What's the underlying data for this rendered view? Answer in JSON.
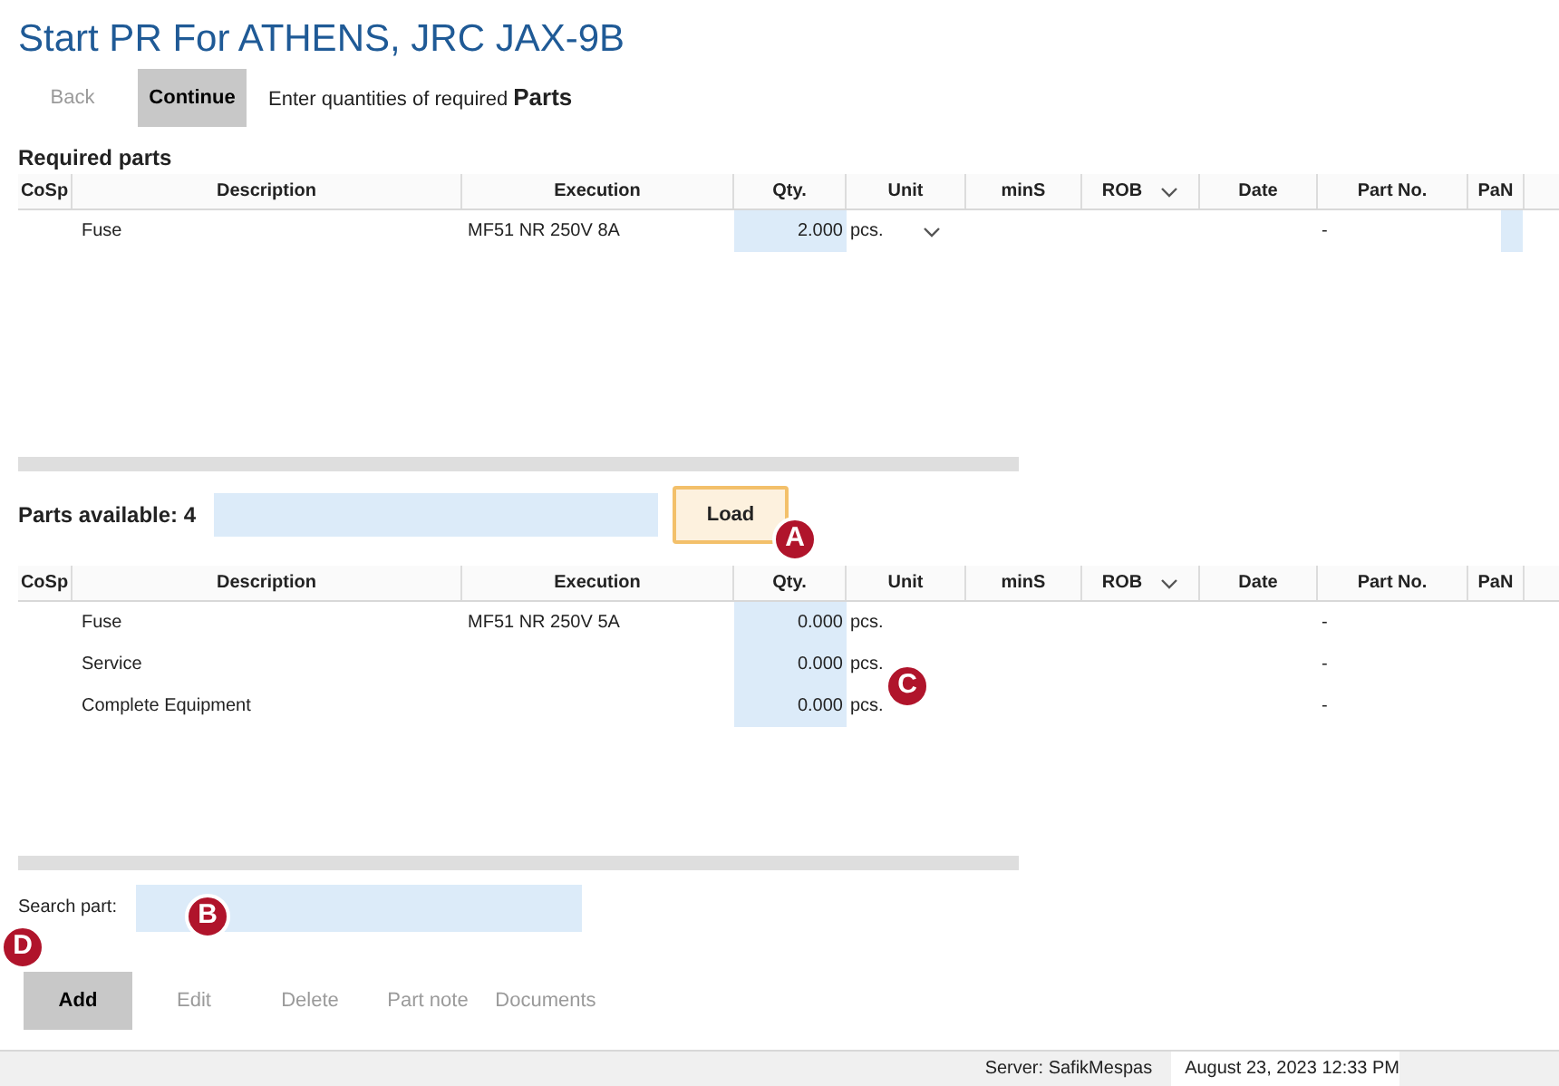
{
  "title": "Start PR For ATHENS, JRC JAX-9B",
  "toolbar": {
    "buttons": [
      {
        "label": "Back",
        "disabled": true,
        "pressed": false
      },
      {
        "label": "Continue",
        "disabled": false,
        "pressed": true
      }
    ],
    "hint": "Enter quantities of required **Parts**"
  },
  "required": {
    "heading": "Required parts",
    "columns": [
      {
        "label": "CoSp",
        "filter": false
      },
      {
        "label": "Description",
        "filter": false
      },
      {
        "label": "Execution",
        "filter": false
      },
      {
        "label": "Qty.",
        "filter": false
      },
      {
        "label": "Unit",
        "filter": false
      },
      {
        "label": "minS",
        "filter": false
      },
      {
        "label": "ROB",
        "filter": true
      },
      {
        "label": "Date",
        "filter": false
      },
      {
        "label": "Part No.",
        "filter": false
      },
      {
        "label": "PaN",
        "filter": false
      }
    ],
    "rows": [
      {
        "description": "Fuse",
        "execution": "MF51 NR 250V 8A",
        "qty": "2.000",
        "unit": "pcs.",
        "unit_dropdown": true,
        "part_no": "-",
        "pan_editable": true
      }
    ]
  },
  "available": {
    "label": "Parts available: 4",
    "load": {
      "label": "Load",
      "focused": true
    },
    "columns": [
      {
        "label": "CoSp",
        "filter": false
      },
      {
        "label": "Description",
        "filter": false
      },
      {
        "label": "Execution",
        "filter": false
      },
      {
        "label": "Qty.",
        "filter": false
      },
      {
        "label": "Unit",
        "filter": false
      },
      {
        "label": "minS",
        "filter": false
      },
      {
        "label": "ROB",
        "filter": true
      },
      {
        "label": "Date",
        "filter": false
      },
      {
        "label": "Part No.",
        "filter": false
      },
      {
        "label": "PaN",
        "filter": false
      }
    ],
    "rows": [
      {
        "description": "Fuse",
        "execution": "MF51 NR 250V 5A",
        "qty": "0.000",
        "unit": "pcs.",
        "unit_dropdown": false,
        "part_no": "-",
        "pan_editable": false
      },
      {
        "description": "Service",
        "qty": "0.000",
        "unit": "pcs.",
        "unit_dropdown": false,
        "part_no": "-",
        "pan_editable": false
      },
      {
        "description": "Complete Equipment",
        "qty": "0.000",
        "unit": "pcs.",
        "unit_dropdown": false,
        "part_no": "-",
        "pan_editable": false
      }
    ]
  },
  "search": {
    "label": "Search part:"
  },
  "actions": [
    {
      "label": "Add",
      "disabled": false,
      "pressed": true
    },
    {
      "label": "Edit",
      "disabled": true,
      "pressed": false
    },
    {
      "label": "Delete",
      "disabled": true,
      "pressed": false
    },
    {
      "label": "Part note",
      "disabled": true,
      "pressed": false
    },
    {
      "label": "Documents",
      "disabled": true,
      "pressed": false
    }
  ],
  "status_bar": {
    "server": "Server: SafikMespas",
    "datetime": "August 23, 2023 12:33 PM"
  },
  "markers": [
    {
      "label": "A"
    },
    {
      "label": "B"
    },
    {
      "label": "C"
    },
    {
      "label": "D"
    }
  ]
}
